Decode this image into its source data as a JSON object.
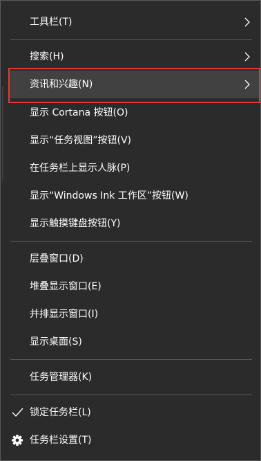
{
  "menu": {
    "items": [
      {
        "label": "工具栏(T)"
      },
      {
        "label": "搜索(H)"
      },
      {
        "label": "资讯和兴趣(N)"
      },
      {
        "label": "显示 Cortana 按钮(O)"
      },
      {
        "label": "显示“任务视图”按钮(V)"
      },
      {
        "label": "在任务栏上显示人脉(P)"
      },
      {
        "label": "显示“Windows Ink 工作区”按钮(W)"
      },
      {
        "label": "显示触摸键盘按钮(Y)"
      },
      {
        "label": "层叠窗口(D)"
      },
      {
        "label": "堆叠显示窗口(E)"
      },
      {
        "label": "并排显示窗口(I)"
      },
      {
        "label": "显示桌面(S)"
      },
      {
        "label": "任务管理器(K)"
      },
      {
        "label": "锁定任务栏(L)",
        "checked": true
      },
      {
        "label": "任务栏设置(T)"
      }
    ]
  },
  "colors": {
    "background": "#2b2b2b",
    "hover": "#414141",
    "highlight_border": "#e23a3a",
    "text": "#ffffff",
    "divider": "#5a5a5a"
  },
  "icons": {
    "submenu": "chevron-right-icon",
    "checked": "checkmark-icon",
    "settings": "gear-icon"
  }
}
